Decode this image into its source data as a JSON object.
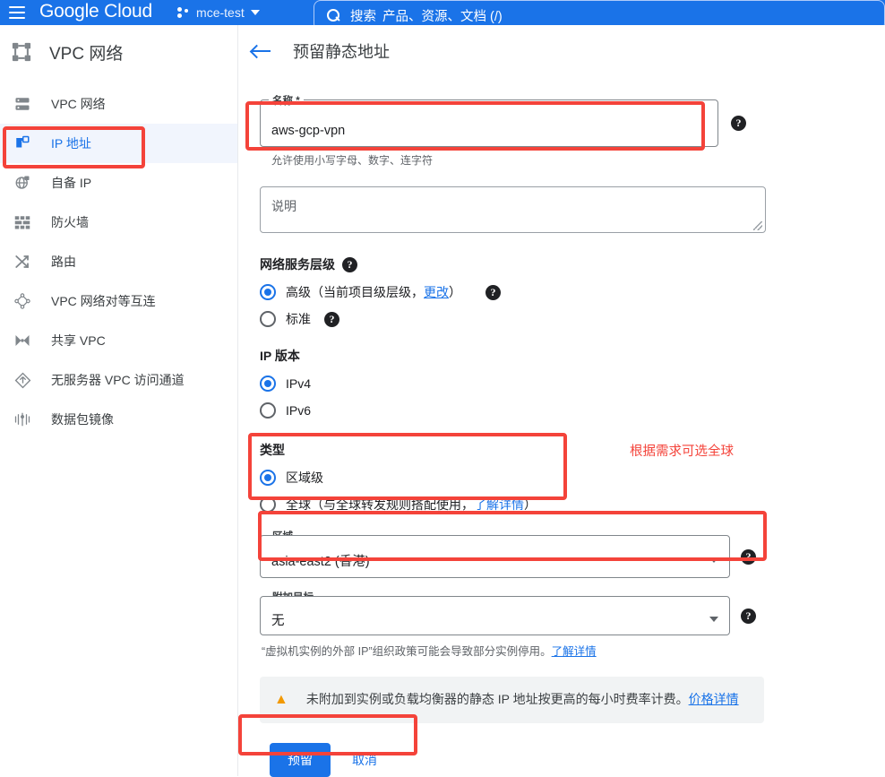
{
  "topbar": {
    "menu_icon": "hamburger-menu-icon",
    "logo": "Google Cloud",
    "project_icon": "project-dots-icon",
    "project_name": "mce-test",
    "project_caret": "chevron-down-icon",
    "search_icon": "search-icon",
    "search_label": "搜索",
    "search_placeholder": "产品、资源、文档 (/)"
  },
  "sidebar": {
    "product_icon": "vpc-network-icon",
    "product_title": "VPC 网络",
    "items": [
      {
        "label": "VPC 网络",
        "icon": "network-list-icon",
        "active": false
      },
      {
        "label": "IP 地址",
        "icon": "ip-address-icon",
        "active": true
      },
      {
        "label": "自备 IP",
        "icon": "globe-ip-icon",
        "active": false
      },
      {
        "label": "防火墙",
        "icon": "firewall-brick-icon",
        "active": false
      },
      {
        "label": "路由",
        "icon": "routes-shuffle-icon",
        "active": false
      },
      {
        "label": "VPC 网络对等互连",
        "icon": "peering-nodes-icon",
        "active": false
      },
      {
        "label": "共享 VPC",
        "icon": "shared-vpc-bowtie-icon",
        "active": false
      },
      {
        "label": "无服务器 VPC 访问通道",
        "icon": "serverless-access-icon",
        "active": false
      },
      {
        "label": "数据包镜像",
        "icon": "packet-mirroring-icon",
        "active": false
      }
    ]
  },
  "page": {
    "back_icon": "back-arrow-icon",
    "title": "预留静态地址"
  },
  "form": {
    "name": {
      "label": "名称 *",
      "value": "aws-gcp-vpn",
      "hint": "允许使用小写字母、数字、连字符",
      "help_icon": "help-circle-icon"
    },
    "description": {
      "placeholder": "说明",
      "resize_icon": "resize-grip-icon"
    },
    "network_tier": {
      "title": "网络服务层级",
      "help_icon": "help-circle-icon",
      "options": [
        {
          "label_before": "高级（当前项目级层级，",
          "link": "更改",
          "label_after": "）",
          "selected": true,
          "help_icon": "help-circle-icon"
        },
        {
          "label_before": "标准",
          "link": "",
          "label_after": "",
          "selected": false,
          "help_icon": "help-circle-icon"
        }
      ]
    },
    "ip_version": {
      "title": "IP 版本",
      "options": [
        {
          "label": "IPv4",
          "selected": true
        },
        {
          "label": "IPv6",
          "selected": false
        }
      ]
    },
    "type": {
      "title": "类型",
      "options": [
        {
          "label_before": "区域级",
          "link": "",
          "label_after": "",
          "selected": true
        },
        {
          "label_before": "全球（与全球转发规则搭配使用，",
          "link": "了解详情",
          "label_after": "）",
          "selected": false
        }
      ]
    },
    "region": {
      "label": "区域",
      "value": "asia-east2 (香港)",
      "caret_icon": "chevron-down-icon",
      "help_icon": "help-circle-icon"
    },
    "attached_target": {
      "label": "附加目标",
      "value": "无",
      "caret_icon": "chevron-down-icon",
      "help_icon": "help-circle-icon",
      "note_text": "“虚拟机实例的外部 IP”组织政策可能会导致部分实例停用。",
      "note_link": "了解详情"
    },
    "warning": {
      "icon": "warning-triangle-icon",
      "text": "未附加到实例或负载均衡器的静态 IP 地址按更高的每小时费率计费。",
      "link": "价格详情"
    },
    "actions": {
      "primary": "预留",
      "secondary": "取消"
    }
  },
  "annotations": {
    "note_global": "根据需求可选全球",
    "highlight_color": "#f4433a",
    "boxes": [
      "sidebar-ip-address-item",
      "name-field",
      "type-section",
      "region-select",
      "action-buttons"
    ]
  }
}
